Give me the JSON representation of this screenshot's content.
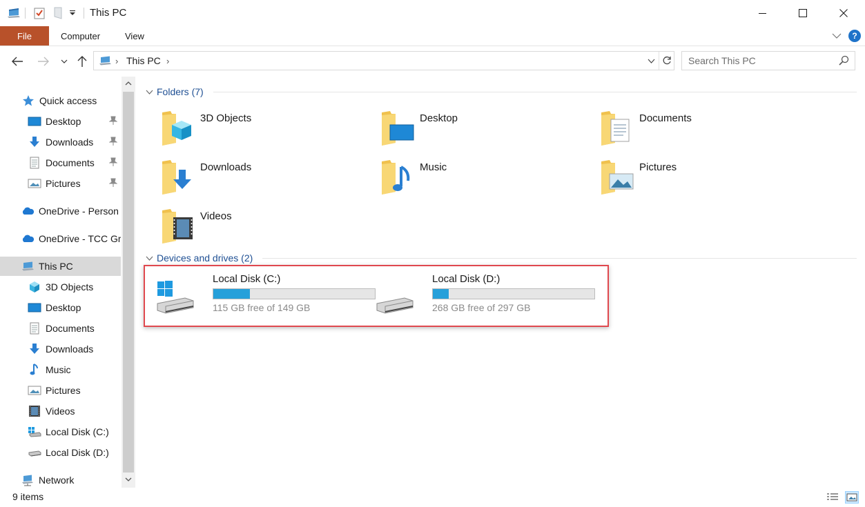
{
  "window": {
    "title": "This PC",
    "controls": {
      "minimize": "minimize",
      "maximize": "maximize",
      "close": "close"
    }
  },
  "ribbon": {
    "tabs": [
      {
        "label": "File"
      },
      {
        "label": "Computer"
      },
      {
        "label": "View"
      }
    ],
    "help": "?"
  },
  "address_bar": {
    "path": "This PC",
    "search_placeholder": "Search This PC"
  },
  "sidebar": {
    "items": [
      {
        "label": "Quick access",
        "icon": "star-icon"
      },
      {
        "label": "Desktop",
        "icon": "desktop-icon",
        "pinned": true
      },
      {
        "label": "Downloads",
        "icon": "download-icon",
        "pinned": true
      },
      {
        "label": "Documents",
        "icon": "document-icon",
        "pinned": true
      },
      {
        "label": "Pictures",
        "icon": "pictures-icon",
        "pinned": true
      },
      {
        "label": "OneDrive - Person",
        "icon": "onedrive-icon"
      },
      {
        "label": "OneDrive - TCC Gr",
        "icon": "onedrive-icon"
      },
      {
        "label": "This PC",
        "icon": "computer-icon",
        "selected": true
      },
      {
        "label": "3D Objects",
        "icon": "cube-icon"
      },
      {
        "label": "Desktop",
        "icon": "desktop-icon"
      },
      {
        "label": "Documents",
        "icon": "document-icon"
      },
      {
        "label": "Downloads",
        "icon": "download-icon"
      },
      {
        "label": "Music",
        "icon": "music-icon"
      },
      {
        "label": "Pictures",
        "icon": "pictures-icon"
      },
      {
        "label": "Videos",
        "icon": "film-icon"
      },
      {
        "label": "Local Disk (C:)",
        "icon": "windows-drive-icon"
      },
      {
        "label": "Local Disk (D:)",
        "icon": "drive-icon"
      },
      {
        "label": "Network",
        "icon": "network-icon"
      }
    ]
  },
  "content": {
    "folders_header": "Folders (7)",
    "folders": [
      {
        "name": "3D Objects",
        "icon": "folder-3d-objects-icon"
      },
      {
        "name": "Desktop",
        "icon": "folder-desktop-icon"
      },
      {
        "name": "Documents",
        "icon": "folder-documents-icon"
      },
      {
        "name": "Downloads",
        "icon": "folder-downloads-icon"
      },
      {
        "name": "Music",
        "icon": "folder-music-icon"
      },
      {
        "name": "Pictures",
        "icon": "folder-pictures-icon"
      },
      {
        "name": "Videos",
        "icon": "folder-videos-icon"
      }
    ],
    "devices_header": "Devices and drives (2)",
    "drives": [
      {
        "name": "Local Disk (C:)",
        "free_text": "115 GB free of 149 GB",
        "used_fraction": 0.228,
        "icon": "windows-drive-icon"
      },
      {
        "name": "Local Disk (D:)",
        "free_text": "268 GB free of 297 GB",
        "used_fraction": 0.098,
        "icon": "drive-icon"
      }
    ]
  },
  "status_bar": {
    "item_count": "9 items"
  },
  "colors": {
    "file_tab": "#b8512a",
    "accent_blue": "#26a0da",
    "group_header": "#1e4f93",
    "highlight": "#e0484e",
    "selected_row": "#d9d9d9"
  }
}
